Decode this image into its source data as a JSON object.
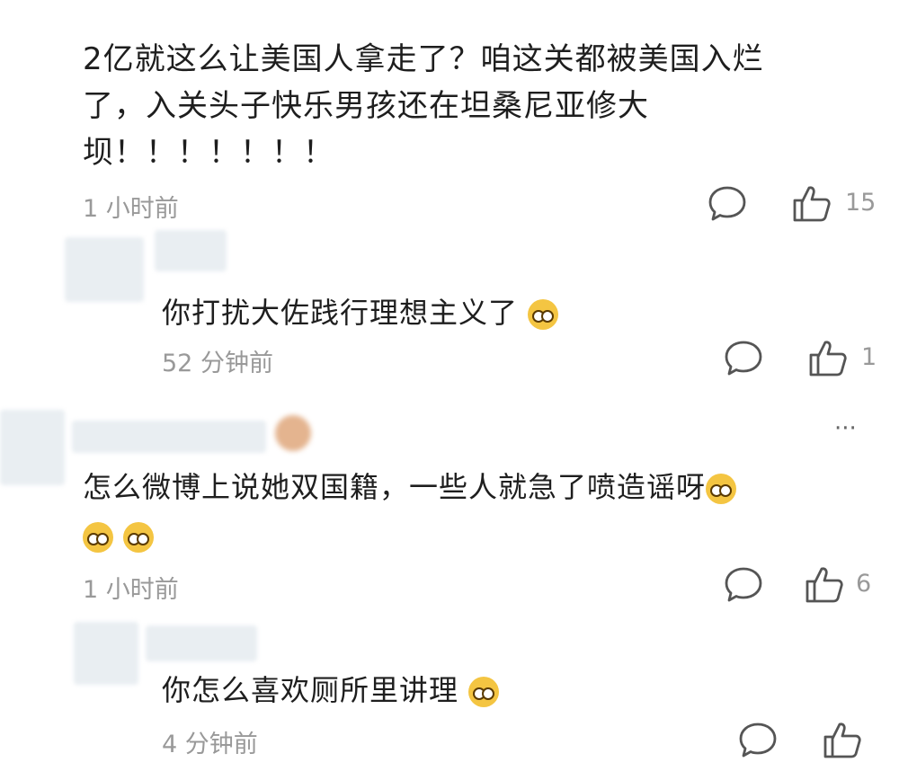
{
  "comment1": {
    "lines": [
      "2亿就这么让美国人拿走了？咱这关都被美国入烂",
      "了，入关头子快乐男孩还在坦桑尼亚修大",
      "坝！！！！！！！"
    ],
    "time": "1 小时前",
    "likes": "15"
  },
  "reply1": {
    "text": "你打扰大佐践行理想主义了",
    "time": "52 分钟前",
    "likes": "1"
  },
  "comment2": {
    "more": "···",
    "line1": "怎么微博上说她双国籍，一些人就急了喷造谣呀",
    "time": "1 小时前",
    "likes": "6"
  },
  "reply2": {
    "text": "你怎么喜欢厕所里讲理",
    "time": "4 分钟前"
  },
  "icons": {
    "comment": "speech-bubble-icon",
    "like": "thumbs-up-icon"
  }
}
